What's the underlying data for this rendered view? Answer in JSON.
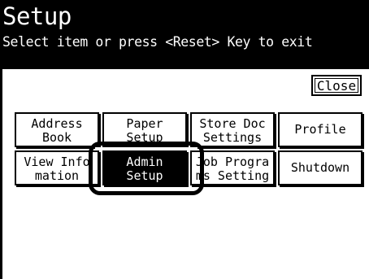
{
  "header": {
    "title": "Setup",
    "subtitle": "Select item or press <Reset> Key to exit"
  },
  "close_label": "Close",
  "buttons": [
    {
      "label": "Address\nBook"
    },
    {
      "label": "Paper\nSetup"
    },
    {
      "label": "Store Doc\nSettings"
    },
    {
      "label": "Profile"
    },
    {
      "label": "View Info\nmation"
    },
    {
      "label": "Admin\nSetup"
    },
    {
      "label": "Job Progra\nms Setting"
    },
    {
      "label": "Shutdown"
    }
  ],
  "selected": "Admin Setup"
}
